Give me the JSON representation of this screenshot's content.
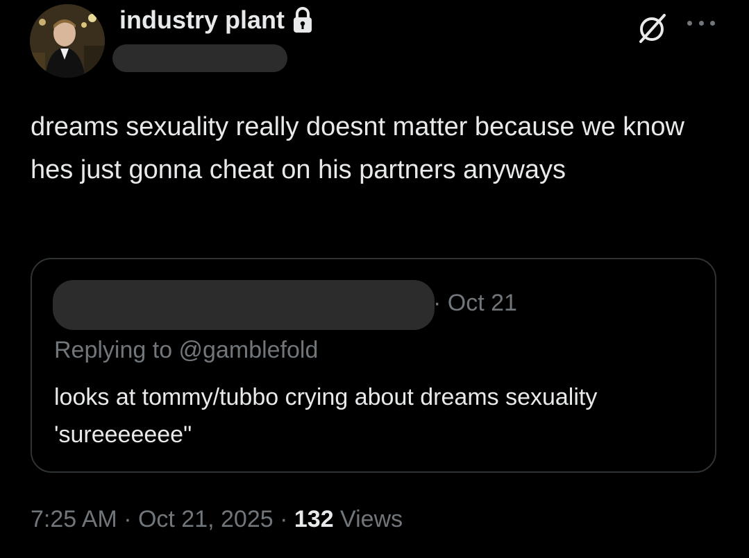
{
  "author": {
    "display_name": "industry plant",
    "verified_locked": true
  },
  "icons": {
    "lock": "lock-icon",
    "grok": "grok-icon",
    "more": "more-options-icon"
  },
  "tweet": {
    "text": "dreams sexuality really doesnt matter because we know hes just gonna cheat on his partners anyways"
  },
  "quoted": {
    "date": "· Oct 21",
    "replying_to": "Replying to @gamblefold",
    "text": "looks at tommy/tubbo crying about dreams sexuality 'sureeeeeee\""
  },
  "meta": {
    "time": "7:25 AM",
    "sep1": " · ",
    "date": "Oct 21, 2025",
    "sep2": " · ",
    "views_count": "132",
    "views_label": " Views"
  },
  "colors": {
    "background": "#000000",
    "text": "#e7e9ea",
    "secondary": "#71767b",
    "border": "#2f3336",
    "redaction": "#2c2c2c"
  }
}
